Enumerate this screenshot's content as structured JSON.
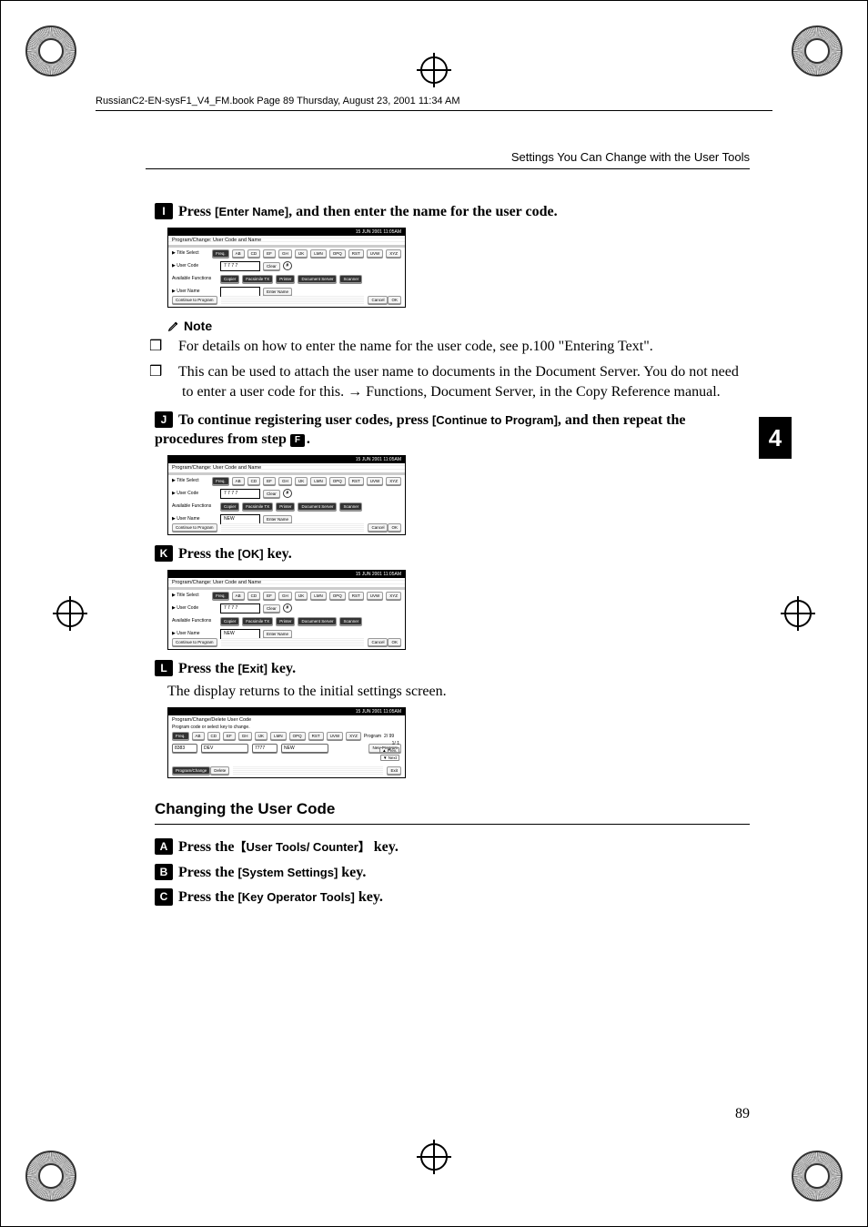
{
  "book_header": "RussianC2-EN-sysF1_V4_FM.book  Page 89  Thursday, August 23, 2001  11:34 AM",
  "running_head": "Settings You Can Change with the User Tools",
  "side_tab": "4",
  "page_number": "89",
  "steps": {
    "s9": {
      "badge": "I",
      "prefix": "Press ",
      "key": "[Enter Name]",
      "suffix": ", and then enter the name for the user code."
    },
    "s10": {
      "badge": "J",
      "prefix": "To continue registering user codes, press ",
      "key": "[Continue to Program]",
      "suffix": ", and then repeat the procedures from step ",
      "ref_badge": "F",
      "tail": "."
    },
    "s11": {
      "badge": "K",
      "prefix": "Press the ",
      "key": "[OK]",
      "suffix": " key."
    },
    "s12": {
      "badge": "L",
      "prefix": "Press the ",
      "key": "[Exit]",
      "suffix": " key."
    },
    "result12": "The display returns to the initial settings screen.",
    "c1": {
      "badge": "A",
      "prefix": "Press the",
      "key": "User Tools/ Counter",
      "suffix": " key."
    },
    "c2": {
      "badge": "B",
      "prefix": "Press the ",
      "key": "[System Settings]",
      "suffix": " key."
    },
    "c3": {
      "badge": "C",
      "prefix": "Press the ",
      "key": "[Key Operator Tools]",
      "suffix": " key."
    }
  },
  "note": {
    "heading": "Note",
    "items": [
      "For details on how to enter the name for the user code, see  p.100 \"Entering Text\".",
      "This can be used to attach the user name to documents in the Document Server. You do not need to enter a user code for this. → Functions, Document Server, in the Copy Reference manual."
    ]
  },
  "section_changing": "Changing the User Code",
  "scr": {
    "time": "15 JUN 2001 11:05AM",
    "title_pc": "Program/Change: User Code and Name",
    "title_pd": "Program/Change/Delete User Code",
    "sub_pd": "Program code or select key to change.",
    "row_title": "▶ Title Select",
    "row_code": "▶ User Code",
    "row_av": "Available Functions",
    "row_un": "▶ User Name",
    "entername": "Enter Name",
    "clear": "Clear",
    "hash": "#",
    "tabs": [
      "Freq.",
      "AB",
      "CD",
      "EF",
      "GH",
      "IJK",
      "LMN",
      "OPQ",
      "RST",
      "UVW",
      "XYZ"
    ],
    "funcs": [
      "Copier",
      "Facsimile TX",
      "Printer",
      "Document Server",
      "Scanner"
    ],
    "user_code": "7 7 7 7",
    "user_name": "NEW",
    "cont": "Continue to Program",
    "cancel": "Cancel",
    "ok": "OK",
    "newprog": "New Program",
    "progchg": "Program/Change",
    "delete": "Delete",
    "exit": "Exit",
    "program": "Program",
    "pgcount": "2/ 99",
    "nav": "1/ 1",
    "prev": "▲ Prev.",
    "next": "▼ Next",
    "list_code1": "8383",
    "list_name1": "DEV",
    "list_code2": "7777",
    "list_name2": "NEW"
  }
}
